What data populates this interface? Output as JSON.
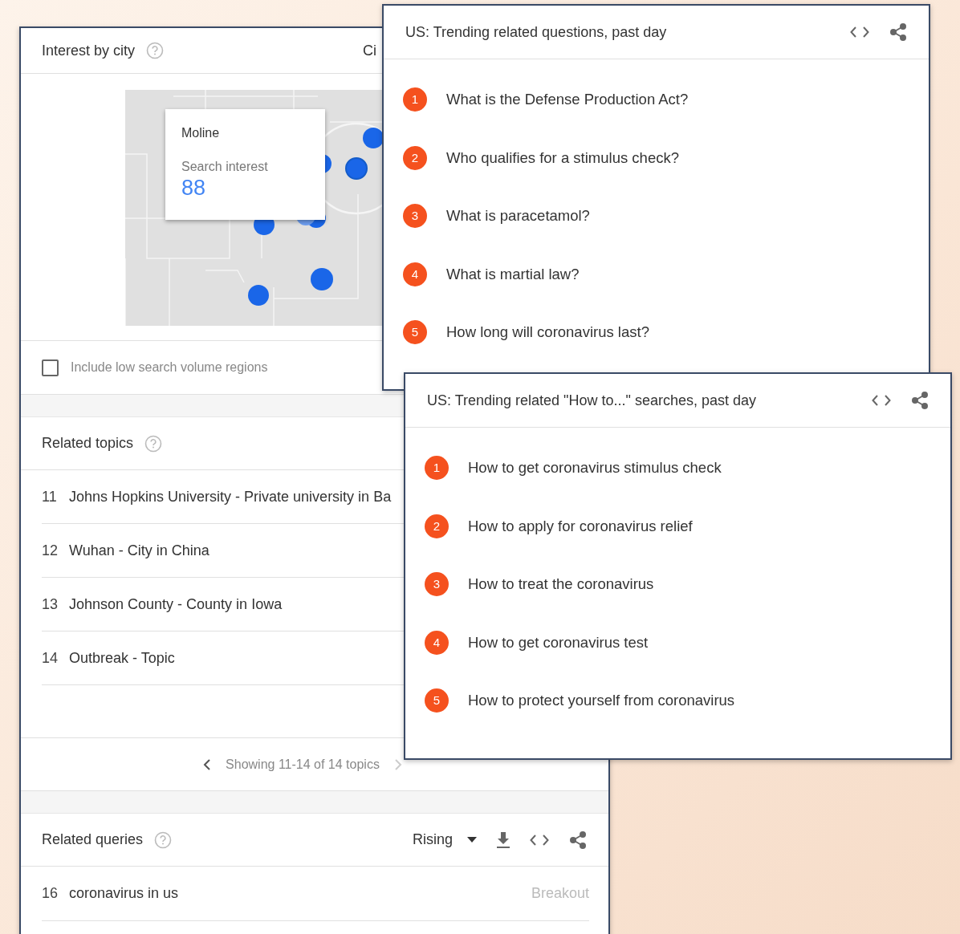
{
  "interest_by_city": {
    "title": "Interest by city",
    "cut_tab": "Ci",
    "tooltip": {
      "city": "Moline",
      "label": "Search interest",
      "value": "88"
    },
    "low_volume_checkbox": {
      "label": "Include low search volume regions",
      "checked": false
    }
  },
  "related_topics": {
    "title": "Related topics",
    "items": [
      {
        "rank": "11",
        "label": "Johns Hopkins University - Private university in Ba"
      },
      {
        "rank": "12",
        "label": "Wuhan - City in China"
      },
      {
        "rank": "13",
        "label": "Johnson County - County in Iowa"
      },
      {
        "rank": "14",
        "label": "Outbreak - Topic"
      }
    ],
    "pagination": "Showing 11-14 of 14 topics"
  },
  "related_queries": {
    "title": "Related queries",
    "filter": "Rising",
    "items": [
      {
        "rank": "16",
        "label": "coronavirus in us",
        "value": "Breakout"
      }
    ]
  },
  "trending_cards": [
    {
      "title": "US: Trending related questions, past day",
      "items": [
        {
          "rank": "1",
          "label": "What is the Defense Production Act?"
        },
        {
          "rank": "2",
          "label": "Who qualifies for a stimulus check?"
        },
        {
          "rank": "3",
          "label": "What is paracetamol?"
        },
        {
          "rank": "4",
          "label": "What is martial law?"
        },
        {
          "rank": "5",
          "label": "How long will coronavirus last?"
        }
      ]
    },
    {
      "title": "US: Trending related \"How to...\" searches, past day",
      "items": [
        {
          "rank": "1",
          "label": "How to get coronavirus stimulus check"
        },
        {
          "rank": "2",
          "label": "How to apply for coronavirus relief"
        },
        {
          "rank": "3",
          "label": "How to treat the coronavirus"
        },
        {
          "rank": "4",
          "label": "How to get coronavirus test"
        },
        {
          "rank": "5",
          "label": "How to protect yourself from coronavirus"
        }
      ]
    }
  ]
}
